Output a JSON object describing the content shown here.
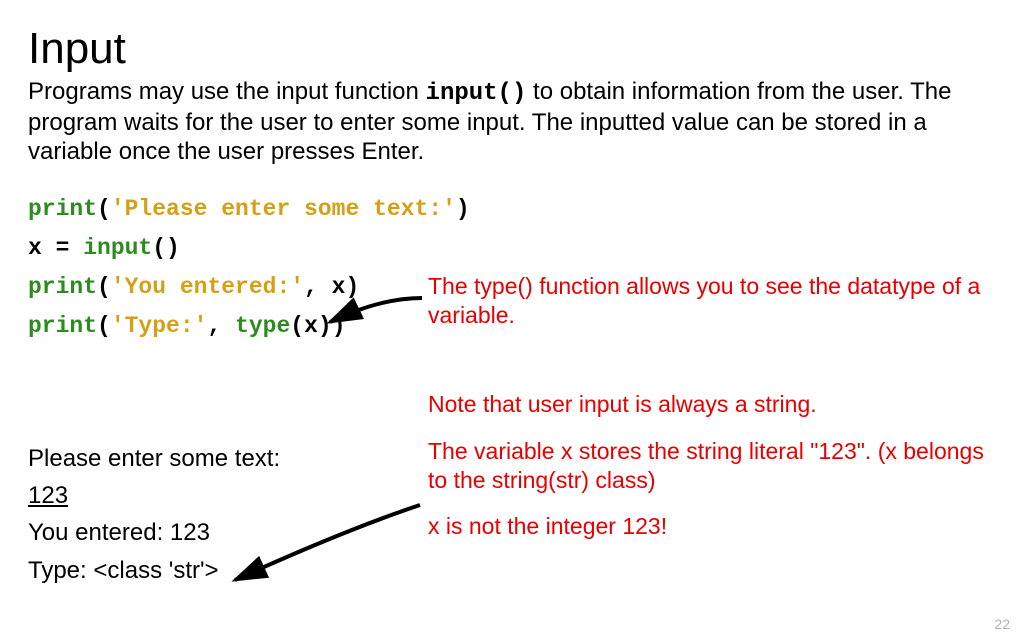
{
  "title": "Input",
  "intro": {
    "part1": "Programs may use the input function ",
    "mono": "input()",
    "part2": " to obtain information from the user. The program waits for the user to enter some input. The inputted value can be stored in a variable once the user presses Enter."
  },
  "code": {
    "l1": {
      "fn": "print",
      "open": "(",
      "str": "'Please enter some text:'",
      "close": ")"
    },
    "l2": {
      "pre": "x = ",
      "fn": "input",
      "post": "()"
    },
    "l3": {
      "fn": "print",
      "open": "(",
      "str": "'You entered:'",
      "rest": ", x)"
    },
    "l4": {
      "fn": "print",
      "open": "(",
      "str": "'Type:'",
      "mid": ", ",
      "fn2": "type",
      "rest": "(x))"
    }
  },
  "annotation1": "The type() function allows you to see the datatype of a variable.",
  "annotation2": {
    "line1": "Note that user input is always a string.",
    "line2": "The variable x stores the string literal \"123\". (x belongs to the string(str) class)",
    "line3": "x is not the integer 123!"
  },
  "output": {
    "prompt": "Please enter some text:",
    "user_input": "123",
    "echo": "You entered: 123",
    "type_line": "Type:  <class 'str'>"
  },
  "page_number": "22"
}
